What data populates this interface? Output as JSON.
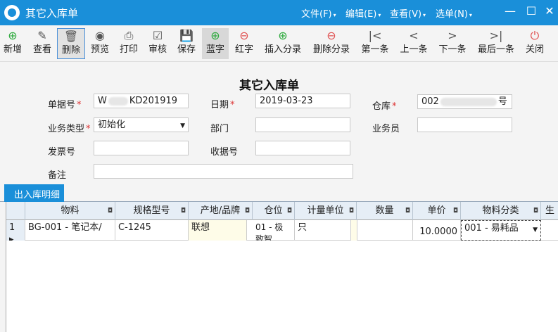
{
  "window": {
    "title": "其它入库单",
    "menus": [
      "文件(F)",
      "编辑(E)",
      "查看(V)",
      "选单(N)"
    ],
    "controls": {
      "minimize": "—",
      "maximize": "☐",
      "close": "✕"
    }
  },
  "toolbar": [
    {
      "label": "新增",
      "icon": "⊕"
    },
    {
      "label": "查看",
      "icon": "✎"
    },
    {
      "label": "删除",
      "icon": "🗑"
    },
    {
      "label": "预览",
      "icon": "◉"
    },
    {
      "label": "打印",
      "icon": "⎙"
    },
    {
      "label": "审核",
      "icon": "☑"
    },
    {
      "label": "保存",
      "icon": "💾"
    },
    {
      "label": "蓝字",
      "icon": "⊕"
    },
    {
      "label": "红字",
      "icon": "⊖"
    },
    {
      "label": "插入分录",
      "icon": "⊕"
    },
    {
      "label": "删除分录",
      "icon": "⊖"
    },
    {
      "label": "第一条",
      "icon": "|<"
    },
    {
      "label": "上一条",
      "icon": "<"
    },
    {
      "label": "下一条",
      "icon": ">"
    },
    {
      "label": "最后一条",
      "icon": ">|"
    },
    {
      "label": "关闭",
      "icon": "⏻"
    }
  ],
  "form": {
    "title": "其它入库单",
    "bill_no_label": "单据号",
    "bill_no_prefix": "W",
    "bill_no_suffix": "KD201919",
    "date_label": "日期",
    "date_value": "2019-03-23",
    "warehouse_label": "仓库",
    "warehouse_prefix": "002",
    "warehouse_suffix": "号",
    "biz_type_label": "业务类型",
    "biz_type_value": "初始化",
    "dept_label": "部门",
    "clerk_label": "业务员",
    "invoice_label": "发票号",
    "receipt_label": "收据号",
    "note_label": "备注",
    "required_mark": "*"
  },
  "tab": {
    "label": "出入库明细"
  },
  "grid": {
    "columns": [
      "物料",
      "规格型号",
      "产地/品牌",
      "仓位",
      "计量单位",
      "数量",
      "单价",
      "物料分类",
      "生"
    ],
    "rows": [
      {
        "index": "1",
        "material": "BG-001 - 笔记本/",
        "spec": "C-1245",
        "brand": "联想",
        "location": "01 - 极致智",
        "unit": "只",
        "qty": "",
        "price": "10.0000",
        "category": "001 - 易耗品"
      }
    ]
  }
}
